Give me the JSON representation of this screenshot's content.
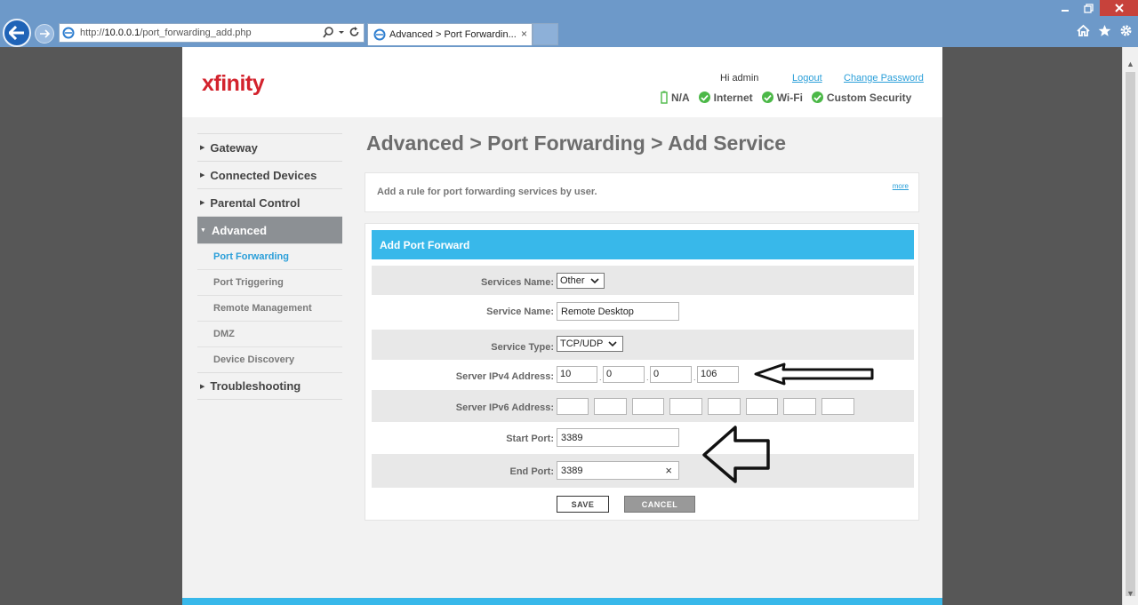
{
  "browser": {
    "url_prefix": "http://",
    "url_host": "10.0.0.1",
    "url_path": "/port_forwarding_add.php",
    "tab_title": "Advanced > Port Forwardin...",
    "tab_close": "×"
  },
  "header": {
    "logo": "xfinity",
    "greeting": "Hi admin",
    "logout": "Logout",
    "change_password": "Change Password",
    "status": {
      "battery": "N/A",
      "internet": "Internet",
      "wifi": "Wi-Fi",
      "security": "Custom Security"
    }
  },
  "sidebar": {
    "gateway": "Gateway",
    "connected_devices": "Connected Devices",
    "parental_control": "Parental Control",
    "advanced": "Advanced",
    "sub": {
      "port_forwarding": "Port Forwarding",
      "port_triggering": "Port Triggering",
      "remote_management": "Remote Management",
      "dmz": "DMZ",
      "device_discovery": "Device Discovery"
    },
    "troubleshooting": "Troubleshooting"
  },
  "main": {
    "title": "Advanced > Port Forwarding > Add Service",
    "description": "Add a rule for port forwarding services by user.",
    "more": "more",
    "form_title": "Add Port Forward",
    "services_name_label": "Services Name:",
    "services_name_value": "Other",
    "service_name_label": "Service Name:",
    "service_name_value": "Remote Desktop",
    "service_type_label": "Service Type:",
    "service_type_value": "TCP/UDP",
    "ipv4_label": "Server IPv4 Address:",
    "ipv4": [
      "10",
      "0",
      "0",
      "106"
    ],
    "ipv6_label": "Server IPv6 Address:",
    "start_port_label": "Start Port:",
    "start_port_value": "3389",
    "end_port_label": "End Port:",
    "end_port_value": "3389",
    "clear_icon": "×",
    "save": "SAVE",
    "cancel": "CANCEL"
  },
  "colors": {
    "accent": "#38b8ea",
    "brand": "#d3232d",
    "link": "#2b9fd9",
    "ok": "#4cb848"
  }
}
